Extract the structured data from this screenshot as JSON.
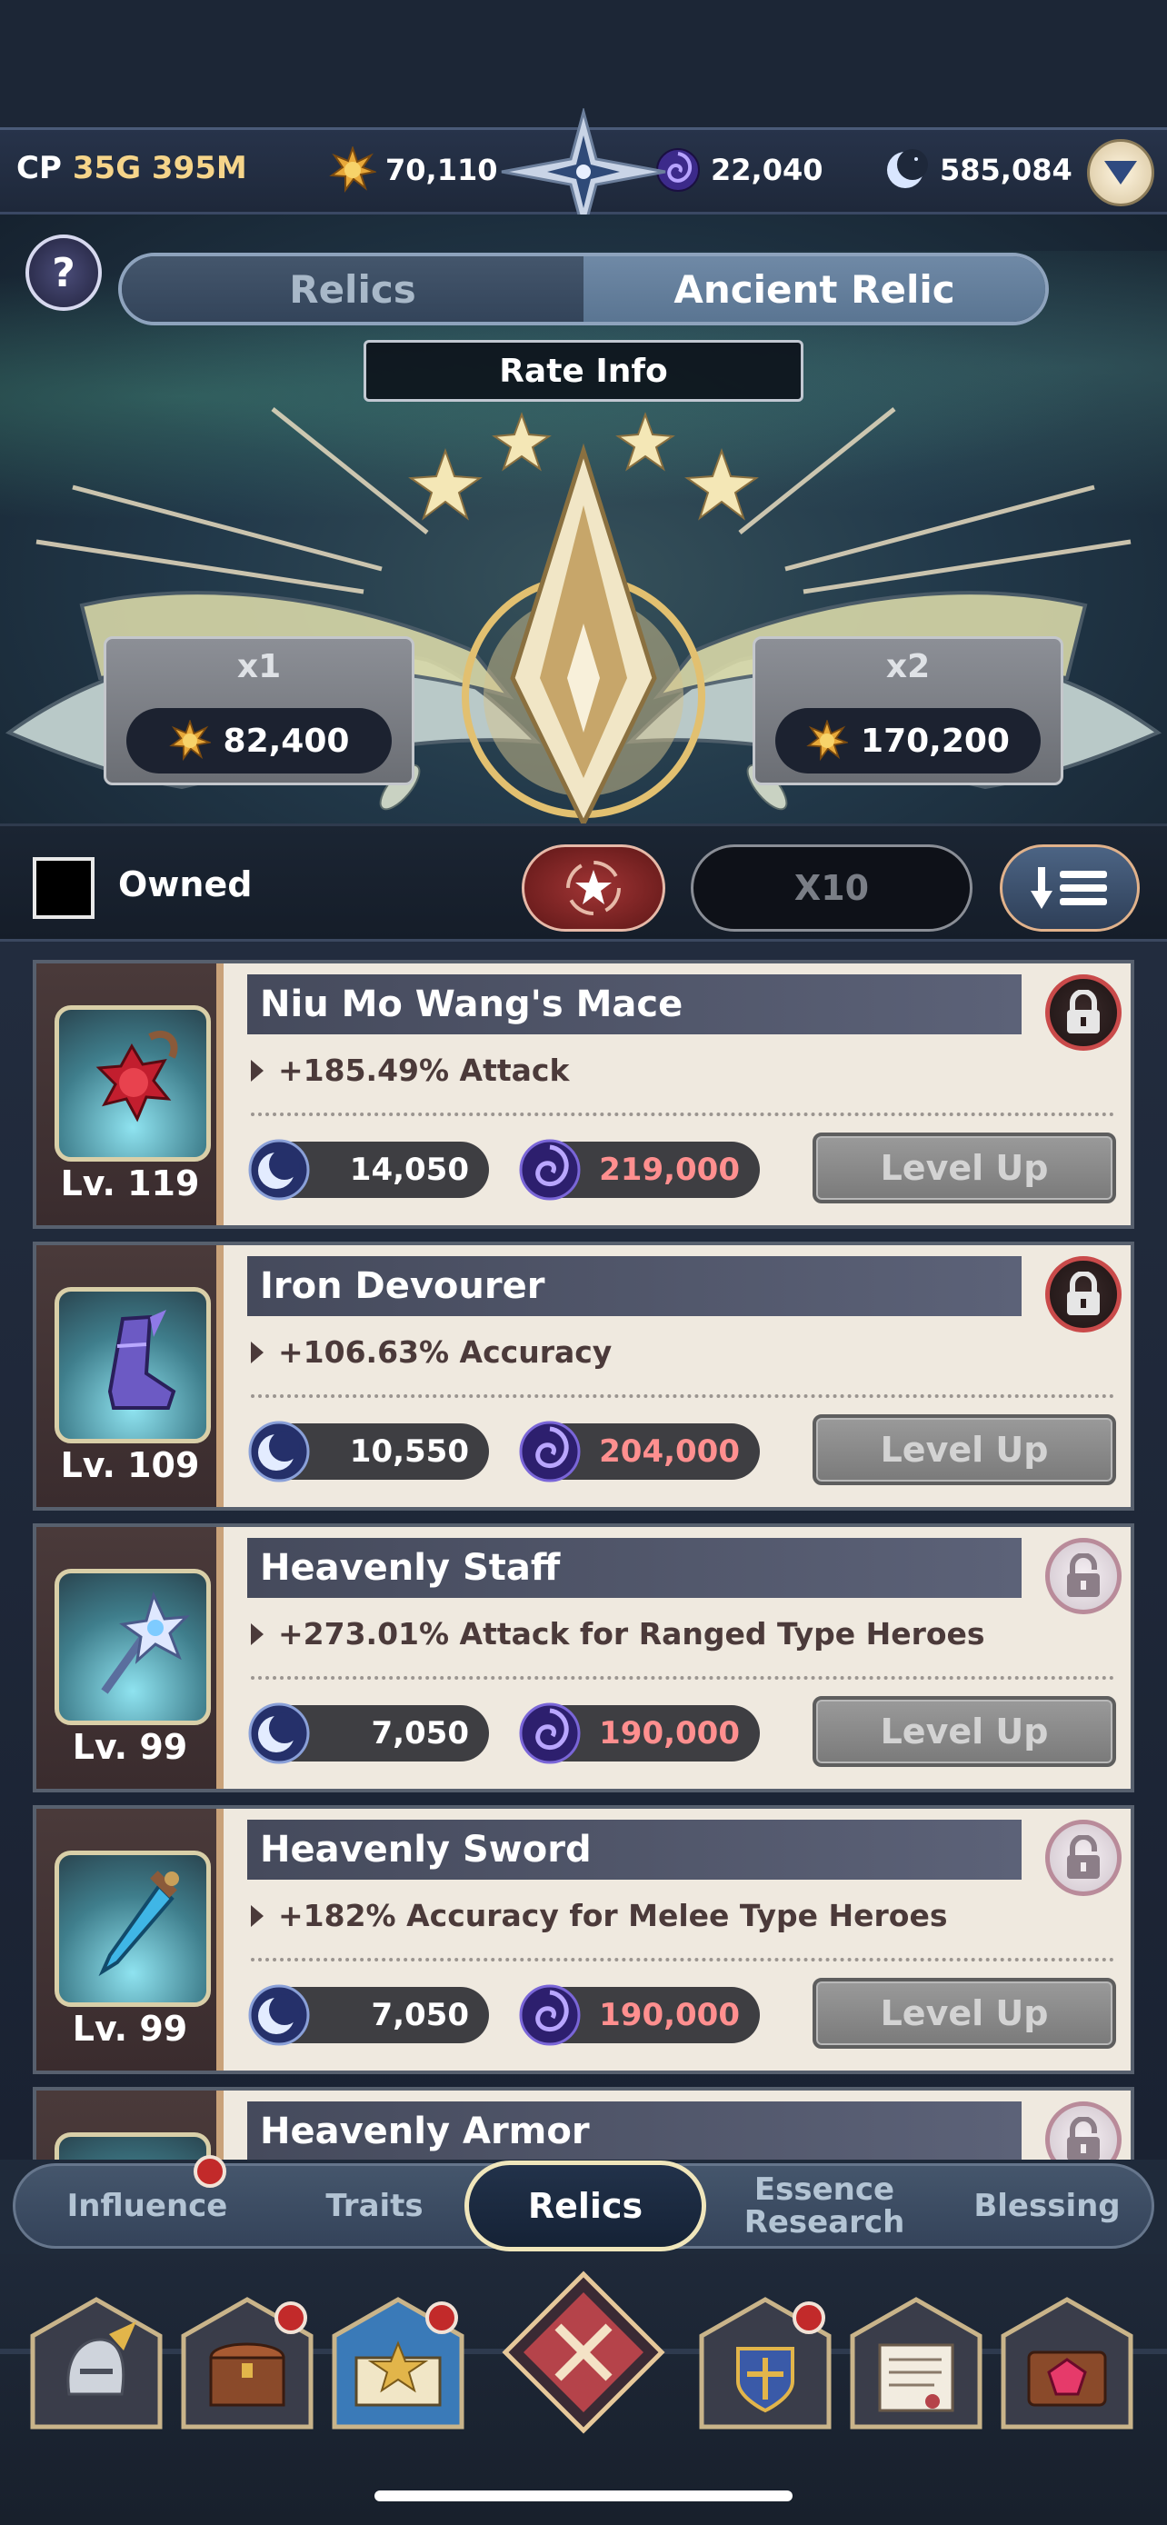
{
  "header": {
    "cp_label": "CP",
    "cp_value": "35G 395M",
    "resources": [
      {
        "icon": "gold-sun-icon",
        "value": "70,110"
      },
      {
        "icon": "purple-orb-icon",
        "value": "22,040"
      },
      {
        "icon": "moon-icon",
        "value": "585,084"
      }
    ]
  },
  "tabs": {
    "items": [
      "Relics",
      "Ancient Relic"
    ],
    "active": "Ancient Relic"
  },
  "rate_info_label": "Rate Info",
  "pulls": [
    {
      "count": "x1",
      "cost": "82,400"
    },
    {
      "count": "x2",
      "cost": "170,200"
    }
  ],
  "filter": {
    "owned_label": "Owned",
    "owned_checked": false,
    "x10_label": "X10"
  },
  "relics": [
    {
      "name": "Niu Mo Wang's Mace",
      "level": "Lv. 119",
      "effect": "+185.49% Attack",
      "moon_cost": "14,050",
      "orb_cost": "219,000",
      "button": "Level Up",
      "locked": true,
      "icon": "spiked-mace-icon"
    },
    {
      "name": "Iron Devourer",
      "level": "Lv. 109",
      "effect": "+106.63% Accuracy",
      "moon_cost": "10,550",
      "orb_cost": "204,000",
      "button": "Level Up",
      "locked": true,
      "icon": "iron-boot-icon"
    },
    {
      "name": "Heavenly Staff",
      "level": "Lv. 99",
      "effect": "+273.01% Attack for Ranged Type Heroes",
      "moon_cost": "7,050",
      "orb_cost": "190,000",
      "button": "Level Up",
      "locked": false,
      "icon": "crystal-staff-icon"
    },
    {
      "name": "Heavenly Sword",
      "level": "Lv. 99",
      "effect": "+182% Accuracy for Melee Type Heroes",
      "moon_cost": "7,050",
      "orb_cost": "190,000",
      "button": "Level Up",
      "locked": false,
      "icon": "blue-sword-icon"
    },
    {
      "name": "Heavenly Armor",
      "locked": false
    }
  ],
  "bottom_tabs": [
    {
      "label": "Influence",
      "notify": true
    },
    {
      "label": "Traits",
      "notify": false
    },
    {
      "label": "Relics",
      "notify": false,
      "active": true
    },
    {
      "label": "Essence Research",
      "notify": false
    },
    {
      "label": "Blessing",
      "notify": false
    }
  ],
  "nav_icons": [
    "knight-helmet-icon",
    "treasure-chest-icon",
    "spellbook-icon",
    "close-icon",
    "shield-emblem-icon",
    "scroll-letter-icon",
    "gem-chest-icon"
  ],
  "colors": {
    "accent_gold": "#f6d58a",
    "orb_cost_red": "#ff8f8f",
    "lock_red": "#c94a4a",
    "notify_red": "#c22a2a"
  }
}
